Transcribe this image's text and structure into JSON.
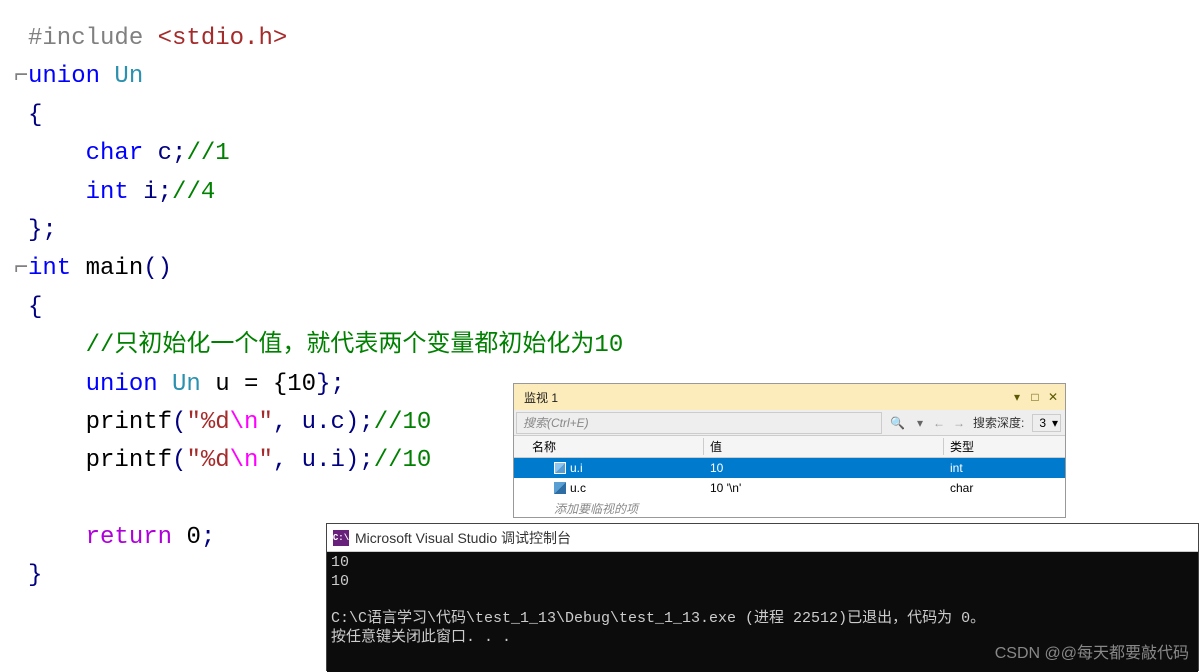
{
  "code": {
    "line1": {
      "preproc": "#include",
      "path": " <stdio.h>"
    },
    "line2": {
      "kw": "union",
      "type": " Un"
    },
    "line3": "{",
    "line4": {
      "indent": "    ",
      "type": "char",
      "rest": " c;",
      "comment": "//1"
    },
    "line5": {
      "indent": "    ",
      "type": "int",
      "rest": " i;",
      "comment": "//4"
    },
    "line6": "};",
    "line7": {
      "type": "int",
      "func": " main",
      "parens": "()"
    },
    "line8": "{",
    "line9": {
      "indent": "    ",
      "comment": "//只初始化一个值，就代表两个变量都初始化为10"
    },
    "line10": {
      "indent": "    ",
      "kw": "union",
      "type": " Un",
      "rest1": " u = {",
      "num": "10",
      "rest2": "};"
    },
    "line11": {
      "indent": "    ",
      "func": "printf",
      "p1": "(",
      "str1": "\"%d",
      "esc": "\\n",
      "str2": "\"",
      "rest": ", u.c);",
      "comment": "//10"
    },
    "line12": {
      "indent": "    ",
      "func": "printf",
      "p1": "(",
      "str1": "\"%d",
      "esc": "\\n",
      "str2": "\"",
      "rest": ", u.i);",
      "comment": "//10"
    },
    "line13": "",
    "line14": {
      "indent": "    ",
      "kw": "return",
      "rest": " ",
      "num": "0",
      "semi": ";"
    },
    "line15": "}"
  },
  "watch": {
    "title": "监视 1",
    "search_placeholder": "搜索(Ctrl+E)",
    "depth_label": "搜索深度:",
    "depth_value": "3",
    "header": {
      "name": "名称",
      "value": "值",
      "type": "类型"
    },
    "rows": [
      {
        "name": "u.i",
        "value": "10",
        "type": "int",
        "selected": true
      },
      {
        "name": "u.c",
        "value": "10 '\\n'",
        "type": "char",
        "selected": false
      }
    ],
    "add_text": "添加要临视的项"
  },
  "console": {
    "title": "Microsoft Visual Studio 调试控制台",
    "icon_text": "C:\\",
    "output_line1": "10",
    "output_line2": "10",
    "exit_line": "C:\\C语言学习\\代码\\test_1_13\\Debug\\test_1_13.exe (进程 22512)已退出，代码为 0。",
    "prompt_line": "按任意键关闭此窗口. . ."
  },
  "watermark": "CSDN @@每天都要敲代码"
}
